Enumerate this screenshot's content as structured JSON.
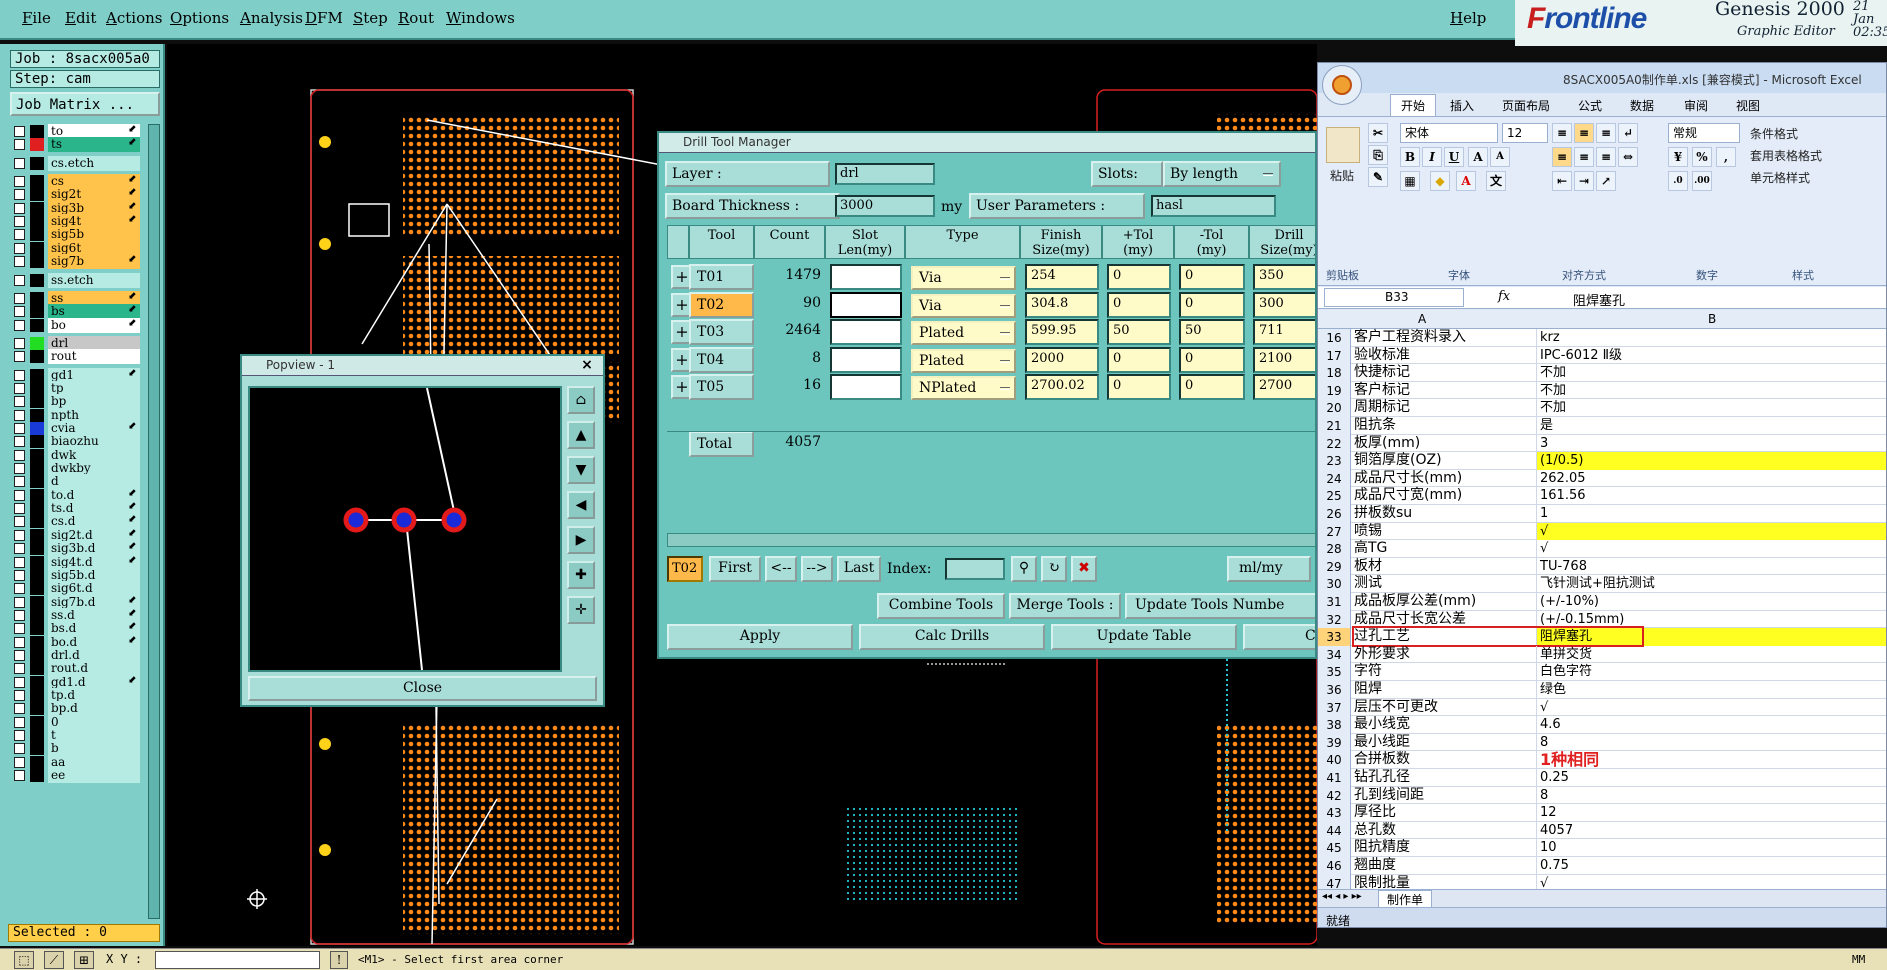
{
  "menubar": {
    "items": [
      "File",
      "Edit",
      "Actions",
      "Options",
      "Analysis",
      "DFM",
      "Step",
      "Rout",
      "Windows"
    ],
    "help": "Help"
  },
  "brand": {
    "logo_a": "F",
    "logo_b": "rontline",
    "title": "Genesis 2000",
    "subtitle": "Graphic Editor",
    "date": "21 Jan",
    "time": "02:35"
  },
  "left": {
    "job": "Job : 8sacx005a0",
    "step": "Step: cam",
    "matrix": "Job Matrix ...",
    "selected": "Selected : 0",
    "layers": [
      {
        "name": "to",
        "color": "#000000",
        "white": true,
        "arrow": true
      },
      {
        "name": "ts",
        "color": "#e02020",
        "green": true,
        "arrow": true
      },
      {
        "name": "cs.etch",
        "color": "#000000",
        "arrow": false
      },
      {
        "name": "cs",
        "color": "#000000",
        "orange": true,
        "arrow": true
      },
      {
        "name": "sig2t",
        "color": "#000000",
        "orange": true,
        "arrow": true
      },
      {
        "name": "sig3b",
        "color": "#000000",
        "orange": true,
        "arrow": true
      },
      {
        "name": "sig4t",
        "color": "#000000",
        "orange": true,
        "arrow": true
      },
      {
        "name": "sig5b",
        "color": "#000000",
        "orange": true,
        "arrow": false
      },
      {
        "name": "sig6t",
        "color": "#000000",
        "orange": true,
        "arrow": false
      },
      {
        "name": "sig7b",
        "color": "#000000",
        "orange": true,
        "arrow": true
      },
      {
        "name": "ss.etch",
        "color": "#000000",
        "arrow": false
      },
      {
        "name": "ss",
        "color": "#000000",
        "orange": true,
        "arrow": true
      },
      {
        "name": "bs",
        "color": "#000000",
        "green": true,
        "arrow": true
      },
      {
        "name": "bo",
        "color": "#000000",
        "white": true,
        "arrow": true
      },
      {
        "name": "drl",
        "color": "#22dd22",
        "gray": true,
        "arrow": false
      },
      {
        "name": "rout",
        "color": "#000000",
        "white2": true,
        "arrow": false
      },
      {
        "name": "gd1",
        "color": "#000000",
        "arrow": true
      },
      {
        "name": "tp",
        "color": "#000000",
        "arrow": false
      },
      {
        "name": "bp",
        "color": "#000000",
        "arrow": false
      },
      {
        "name": "npth",
        "color": "#000000",
        "arrow": false
      },
      {
        "name": "cvia",
        "color": "#1a3ad8",
        "arrow": true
      },
      {
        "name": "biaozhu",
        "color": "#000000",
        "arrow": false
      },
      {
        "name": "dwk",
        "color": "#000000",
        "arrow": false
      },
      {
        "name": "dwkby",
        "color": "#000000",
        "arrow": false
      },
      {
        "name": "d",
        "color": "#000000",
        "arrow": false
      },
      {
        "name": "to.d",
        "color": "#000000",
        "arrow": true
      },
      {
        "name": "ts.d",
        "color": "#000000",
        "arrow": true
      },
      {
        "name": "cs.d",
        "color": "#000000",
        "arrow": true
      },
      {
        "name": "sig2t.d",
        "color": "#000000",
        "arrow": true
      },
      {
        "name": "sig3b.d",
        "color": "#000000",
        "arrow": true
      },
      {
        "name": "sig4t.d",
        "color": "#000000",
        "arrow": true
      },
      {
        "name": "sig5b.d",
        "color": "#000000",
        "arrow": false
      },
      {
        "name": "sig6t.d",
        "color": "#000000",
        "arrow": false
      },
      {
        "name": "sig7b.d",
        "color": "#000000",
        "arrow": true
      },
      {
        "name": "ss.d",
        "color": "#000000",
        "arrow": true
      },
      {
        "name": "bs.d",
        "color": "#000000",
        "arrow": true
      },
      {
        "name": "bo.d",
        "color": "#000000",
        "arrow": true
      },
      {
        "name": "drl.d",
        "color": "#000000",
        "arrow": false
      },
      {
        "name": "rout.d",
        "color": "#000000",
        "arrow": false
      },
      {
        "name": "gd1.d",
        "color": "#000000",
        "arrow": true
      },
      {
        "name": "tp.d",
        "color": "#000000",
        "arrow": false
      },
      {
        "name": "bp.d",
        "color": "#000000",
        "arrow": false
      },
      {
        "name": "0",
        "color": "#000000",
        "arrow": false
      },
      {
        "name": "t",
        "color": "#000000",
        "arrow": false
      },
      {
        "name": "b",
        "color": "#000000",
        "arrow": false
      },
      {
        "name": "aa",
        "color": "#000000",
        "arrow": false
      },
      {
        "name": "ee",
        "color": "#000000",
        "arrow": false
      }
    ]
  },
  "status": {
    "xy_label": "X Y :",
    "hint": "<M1> - Select first area corner",
    "mm": "MM"
  },
  "popview": {
    "title": "Popview - 1",
    "close": "Close",
    "close_x": "×"
  },
  "dtm": {
    "title": "Drill Tool Manager",
    "layer_label": "Layer          :",
    "layer_value": "drl",
    "slots_label": "Slots:",
    "slots_value": "By length",
    "board_label": "Board Thickness :",
    "board_value": "3000",
    "board_unit": "my",
    "user_params_label": "User Parameters :",
    "user_params_value": "hasl",
    "headers": [
      "Tool",
      "Count",
      "Slot\nLen(my)",
      "Type",
      "Finish\nSize(my)",
      "+Tol\n(my)",
      "-Tol\n(my)",
      "Drill\nSize(my)"
    ],
    "rows": [
      {
        "tool": "T01",
        "count": "1479",
        "type": "Via",
        "finish": "254",
        "ptol": "0",
        "ntol": "0",
        "drill": "350"
      },
      {
        "tool": "T02",
        "count": "90",
        "type": "Via",
        "finish": "304.8",
        "ptol": "0",
        "ntol": "0",
        "drill": "300"
      },
      {
        "tool": "T03",
        "count": "2464",
        "type": "Plated",
        "finish": "599.95",
        "ptol": "50",
        "ntol": "50",
        "drill": "711"
      },
      {
        "tool": "T04",
        "count": "8",
        "type": "Plated",
        "finish": "2000",
        "ptol": "0",
        "ntol": "0",
        "drill": "2100"
      },
      {
        "tool": "T05",
        "count": "16",
        "type": "NPlated",
        "finish": "2700.02",
        "ptol": "0",
        "ntol": "0",
        "drill": "2700"
      }
    ],
    "total_label": "Total",
    "total_count": "4057",
    "current_tool": "T02",
    "nav_first": "First",
    "nav_prev": "<--",
    "nav_next": "-->",
    "nav_last": "Last",
    "index_label": "Index:",
    "units": "ml/my",
    "combine": "Combine Tools",
    "merge": "Merge Tools :",
    "update_numbers": "Update Tools Numbe",
    "apply": "Apply",
    "calc": "Calc Drills",
    "update_table": "Update Table",
    "c": "C"
  },
  "excel": {
    "title": "8SACX005A0制作单.xls  [兼容模式] - Microsoft Excel",
    "tabs": [
      "开始",
      "插入",
      "页面布局",
      "公式",
      "数据",
      "审阅",
      "视图"
    ],
    "groups": [
      "剪贴板",
      "字体",
      "对齐方式",
      "数字",
      "样式"
    ],
    "paste": "粘贴",
    "font": "宋体",
    "size": "12",
    "numfmt": "常规",
    "bold": "B",
    "italic": "I",
    "underline": "U",
    "cond_fmt": "条件格式",
    "table_fmt": "套用表格格式",
    "cell_style": "单元格样式",
    "namebox": "B33",
    "fx": "fx",
    "formula": "阻焊塞孔",
    "col_a": "A",
    "col_b": "B",
    "rows": [
      {
        "n": "16",
        "a": "客户工程资料录入",
        "b": "krz"
      },
      {
        "n": "17",
        "a": "验收标准",
        "b": "IPC-6012 Ⅱ级"
      },
      {
        "n": "18",
        "a": "快捷标记",
        "b": "不加"
      },
      {
        "n": "19",
        "a": "客户标记",
        "b": "不加"
      },
      {
        "n": "20",
        "a": "周期标记",
        "b": "不加"
      },
      {
        "n": "21",
        "a": "阻抗条",
        "b": "是"
      },
      {
        "n": "22",
        "a": "板厚(mm)",
        "b": "3"
      },
      {
        "n": "23",
        "a": "铜箔厚度(OZ)",
        "b": "(1/0.5)",
        "hl": true
      },
      {
        "n": "24",
        "a": "成品尺寸长(mm)",
        "b": "262.05"
      },
      {
        "n": "25",
        "a": "成品尺寸宽(mm)",
        "b": "161.56"
      },
      {
        "n": "26",
        "a": "拼板数su",
        "b": "1"
      },
      {
        "n": "27",
        "a": "喷锡",
        "b": "√",
        "hl": true
      },
      {
        "n": "28",
        "a": "高TG",
        "b": "√"
      },
      {
        "n": "29",
        "a": "板材",
        "b": "TU-768"
      },
      {
        "n": "30",
        "a": "测试",
        "b": "飞针测试+阻抗测试"
      },
      {
        "n": "31",
        "a": "成品板厚公差(mm)",
        "b": "(+/-10%)"
      },
      {
        "n": "32",
        "a": "成品尺寸长宽公差",
        "b": "(+/-0.15mm)"
      },
      {
        "n": "33",
        "a": "过孔工艺",
        "b": "阻焊塞孔",
        "hl": true,
        "boxed": true
      },
      {
        "n": "34",
        "a": "外形要求",
        "b": "单拼交货"
      },
      {
        "n": "35",
        "a": "字符",
        "b": "白色字符"
      },
      {
        "n": "36",
        "a": "阻焊",
        "b": "绿色"
      },
      {
        "n": "37",
        "a": "层压不可更改",
        "b": "√"
      },
      {
        "n": "38",
        "a": "最小线宽",
        "b": "4.6"
      },
      {
        "n": "39",
        "a": "最小线距",
        "b": "8"
      },
      {
        "n": "40",
        "a": "合拼板数",
        "b": "1种相同",
        "red": true
      },
      {
        "n": "41",
        "a": "钻孔孔径",
        "b": "0.25"
      },
      {
        "n": "42",
        "a": "孔到线间距",
        "b": "8"
      },
      {
        "n": "43",
        "a": "厚径比",
        "b": "12"
      },
      {
        "n": "44",
        "a": "总孔数",
        "b": "4057"
      },
      {
        "n": "45",
        "a": "阻抗精度",
        "b": "10"
      },
      {
        "n": "46",
        "a": "翘曲度",
        "b": "0.75"
      },
      {
        "n": "47",
        "a": "限制批量",
        "b": "√"
      }
    ],
    "sheet_tab": "制作单",
    "status": "就绪"
  }
}
